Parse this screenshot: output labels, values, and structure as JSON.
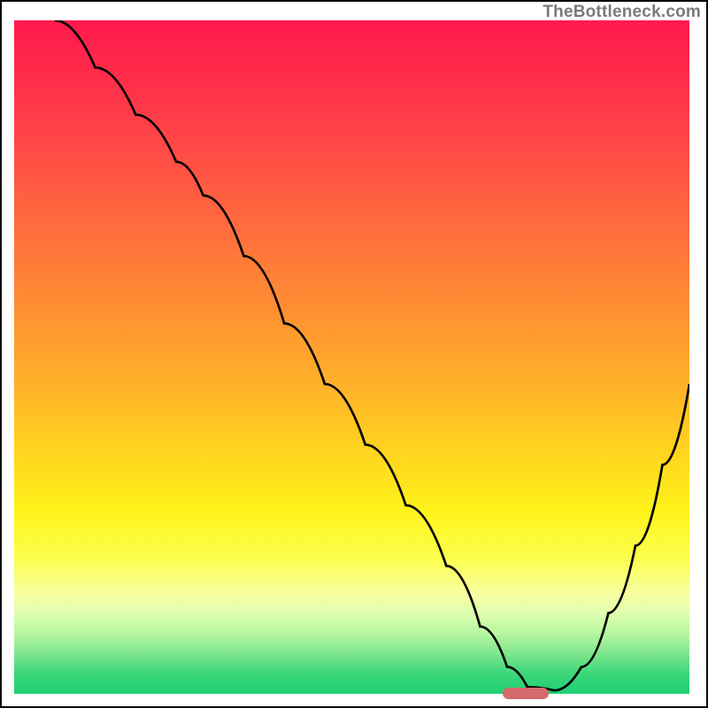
{
  "attribution": "TheBottleneck.com",
  "colors": {
    "curve": "#000000",
    "marker": "#d56a6d",
    "frame_border": "#000000",
    "gradient_top": "#ff1a4d",
    "gradient_bottom": "#1fcf74"
  },
  "marker": {
    "x_frac": 0.724,
    "width_frac": 0.068
  },
  "chart_data": {
    "type": "line",
    "title": "",
    "xlabel": "",
    "ylabel": "",
    "xlim": [
      0,
      100
    ],
    "ylim": [
      0,
      100
    ],
    "grid": false,
    "legend": false,
    "series": [
      {
        "name": "curve",
        "x": [
          6,
          12,
          18,
          24,
          28,
          34,
          40,
          46,
          52,
          58,
          64,
          69,
          73,
          76,
          80,
          84,
          88,
          92,
          96,
          100
        ],
        "y": [
          100,
          93,
          86,
          79,
          74,
          65,
          55,
          46,
          37,
          28,
          19,
          10,
          4,
          1,
          0.5,
          4,
          12,
          22,
          34,
          46
        ]
      }
    ],
    "marker_segment": {
      "x_start": 72.4,
      "x_end": 79.2,
      "y": 0
    },
    "axes_visible": false,
    "background": "red-yellow-green vertical gradient"
  }
}
